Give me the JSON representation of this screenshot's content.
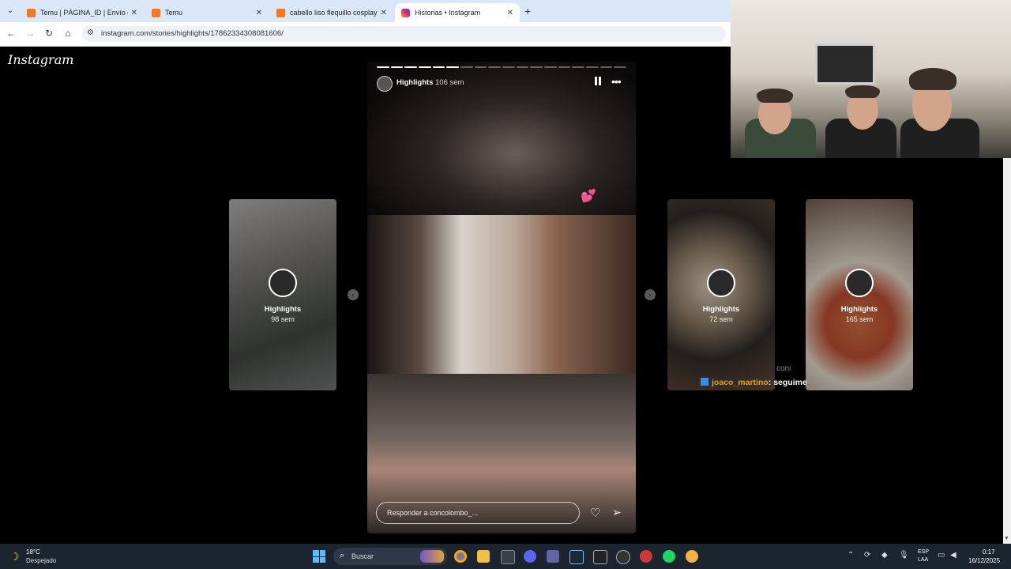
{
  "browser": {
    "tabs": [
      {
        "label": "Temu | PÁGINA_ID | Envío gratu",
        "icon": "temu-icon",
        "active": false
      },
      {
        "label": "Temu",
        "icon": "temu-icon",
        "active": false
      },
      {
        "label": "cabello liso flequillo cosplay fle",
        "icon": "temu-icon",
        "active": false
      },
      {
        "label": "Historias • Instagram",
        "icon": "instagram-icon",
        "active": true
      }
    ],
    "url": "instagram.com/stories/highlights/17862334308081606/"
  },
  "instagram": {
    "logo": "Instagram",
    "story": {
      "username": "Highlights",
      "time": "106 sem",
      "progress_segments": 18,
      "progress_done": 6,
      "reply_placeholder": "Responder a concolombo_..."
    },
    "cards": [
      {
        "title": "Highlights",
        "time": "98 sem"
      },
      {
        "title": "Highlights",
        "time": "72 sem"
      },
      {
        "title": "Highlights",
        "time": "165 sem"
      }
    ]
  },
  "chat": {
    "faded_user": "coni",
    "user": "joaco_martino",
    "message": ": seguime"
  },
  "taskbar": {
    "weather_temp": "18°C",
    "weather_desc": "Despejado",
    "search_placeholder": "Buscar",
    "lang_top": "ESP",
    "lang_bottom": "LAA",
    "time": "0:17",
    "date": "16/12/2025"
  },
  "colors": {
    "accent_chat_user": "#e3a21a",
    "taskbar_bg": "#1c2430",
    "tabbar_bg": "#d9e7f8"
  }
}
